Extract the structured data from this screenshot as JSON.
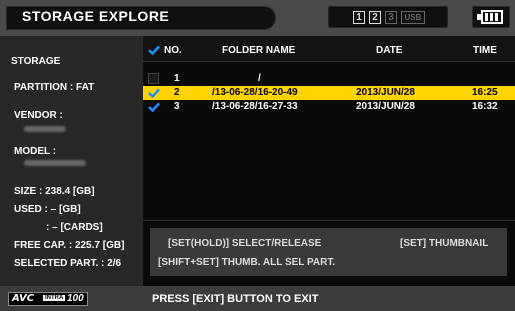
{
  "title": "STORAGE EXPLORE",
  "slots": {
    "s1": "1",
    "s2": "2",
    "s3": "3",
    "usb": "USB"
  },
  "battery_icon": "battery-icon",
  "storage": {
    "heading": "STORAGE",
    "partition": "PARTITION : FAT",
    "vendor_label": "VENDOR :",
    "model_label": "MODEL :",
    "size": "SIZE : 238.4 [GB]",
    "used": "USED : – [GB]",
    "cards": ": – [CARDS]",
    "free": "FREE CAP. : 225.7 [GB]",
    "selected": "SELECTED PART. : 2/6"
  },
  "table": {
    "headers": {
      "no": "NO.",
      "folder": "FOLDER NAME",
      "date": "DATE",
      "time": "TIME"
    },
    "rows": [
      {
        "no": "1",
        "folder": "/",
        "date": "",
        "time": "",
        "checked": false,
        "selected": false
      },
      {
        "no": "2",
        "folder": "/13-06-28/16-20-49",
        "date": "2013/JUN/28",
        "time": "16:25",
        "checked": true,
        "selected": true
      },
      {
        "no": "3",
        "folder": "/13-06-28/16-27-33",
        "date": "2013/JUN/28",
        "time": "16:32",
        "checked": true,
        "selected": false
      }
    ]
  },
  "instructions": {
    "line1_left": "[SET(HOLD)] SELECT/RELEASE",
    "line1_right": "[SET] THUMBNAIL",
    "line2": "[SHIFT+SET] THUMB. ALL SEL PART."
  },
  "footer": {
    "logo_avc": "AVC",
    "logo_intra": "INTRA",
    "logo_num": "100",
    "exit_msg": "PRESS [EXIT] BUTTON TO EXIT"
  },
  "colors": {
    "selected_row": "#ffd400",
    "check": "#1e90ff"
  }
}
